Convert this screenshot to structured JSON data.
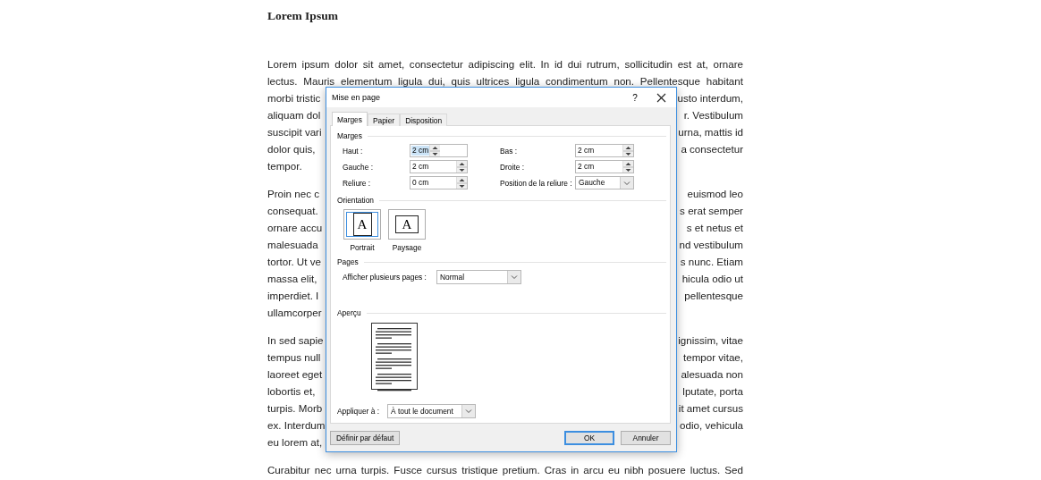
{
  "document": {
    "heading": "Lorem Ipsum",
    "paragraphs": [
      {
        "lines": [
          {
            "kind": "full",
            "text": "Lorem ipsum dolor sit amet, consectetur adipiscing elit. In id dui rutrum, sollicitudin est at, ornare"
          },
          {
            "kind": "full",
            "text": "lectus. Mauris elementum ligula dui, quis ultrices ligula condimentum non. Pellentesque habitant"
          },
          {
            "kind": "split",
            "left": "morbi tristic",
            "right": "usto interdum,"
          },
          {
            "kind": "split",
            "left": "aliquam dol",
            "right": "r. Vestibulum"
          },
          {
            "kind": "split",
            "left": "suscipit vari",
            "right": "urna, mattis id"
          },
          {
            "kind": "split",
            "left": "dolor quis,",
            "right": "a consectetur"
          },
          {
            "kind": "end",
            "text": "tempor."
          }
        ]
      },
      {
        "lines": [
          {
            "kind": "split",
            "left": "Proin nec c",
            "right": "euismod leo"
          },
          {
            "kind": "split",
            "left": "consequat.",
            "right": "s erat semper"
          },
          {
            "kind": "split",
            "left": "ornare accu",
            "right": "s et netus et"
          },
          {
            "kind": "split",
            "left": "malesuada",
            "right": "nd vestibulum"
          },
          {
            "kind": "split",
            "left": "tortor. Ut ve",
            "right": "s nunc. Etiam"
          },
          {
            "kind": "split",
            "left": "massa elit,",
            "right": "hicula odio ut"
          },
          {
            "kind": "split",
            "left": "imperdiet. I",
            "right": "pellentesque"
          },
          {
            "kind": "end",
            "text": "ullamcorper"
          }
        ]
      },
      {
        "lines": [
          {
            "kind": "split",
            "left": "In sed sapie",
            "right": "ignissim, vitae"
          },
          {
            "kind": "split",
            "left": "tempus null",
            "right": "tempor vitae,"
          },
          {
            "kind": "split",
            "left": "laoreet eget",
            "right": "alesuada non"
          },
          {
            "kind": "split",
            "left": "lobortis et,",
            "right": "lputate, porta"
          },
          {
            "kind": "split",
            "left": "turpis. Morb",
            "right": "it amet cursus"
          },
          {
            "kind": "split",
            "left": "ex. Interdum",
            "right": "odio, vehicula"
          },
          {
            "kind": "end",
            "text": "eu lorem at,"
          }
        ]
      },
      {
        "lines": [
          {
            "kind": "full",
            "text": "Curabitur nec urna turpis. Fusce cursus tristique pretium. Cras in arcu eu nibh posuere luctus. Sed"
          }
        ]
      }
    ]
  },
  "dialog": {
    "title": "Mise en page",
    "help_button": "?",
    "tabs": [
      {
        "label": "Marges",
        "selected": true
      },
      {
        "label": "Papier",
        "selected": false
      },
      {
        "label": "Disposition",
        "selected": false
      }
    ],
    "margins": {
      "heading": "Marges",
      "fields": [
        {
          "kind": "spin",
          "label": "Haut :",
          "value": "2 cm",
          "highlighted": true
        },
        {
          "kind": "spin",
          "label": "Bas :",
          "value": "2 cm",
          "highlighted": false
        },
        {
          "kind": "spin",
          "label": "Gauche :",
          "value": "2 cm",
          "highlighted": false
        },
        {
          "kind": "spin",
          "label": "Droite :",
          "value": "2 cm",
          "highlighted": false
        },
        {
          "kind": "spin",
          "label": "Reliure :",
          "value": "0 cm",
          "highlighted": false
        },
        {
          "kind": "dropdown",
          "label": "Position de la reliure :",
          "value": "Gauche"
        }
      ]
    },
    "orientation": {
      "heading": "Orientation",
      "options": [
        {
          "label": "Portrait",
          "glyph": "A",
          "selected": true
        },
        {
          "label": "Paysage",
          "glyph": "A",
          "selected": false
        }
      ]
    },
    "pages": {
      "heading": "Pages",
      "label": "Afficher plusieurs pages :",
      "value": "Normal"
    },
    "preview": {
      "heading": "Aperçu"
    },
    "apply": {
      "label": "Appliquer à :",
      "value": "À tout le document"
    },
    "buttons": [
      {
        "label": "Définir par défaut",
        "default": false
      },
      {
        "label": "OK",
        "default": true
      },
      {
        "label": "Annuler",
        "default": false
      }
    ]
  }
}
